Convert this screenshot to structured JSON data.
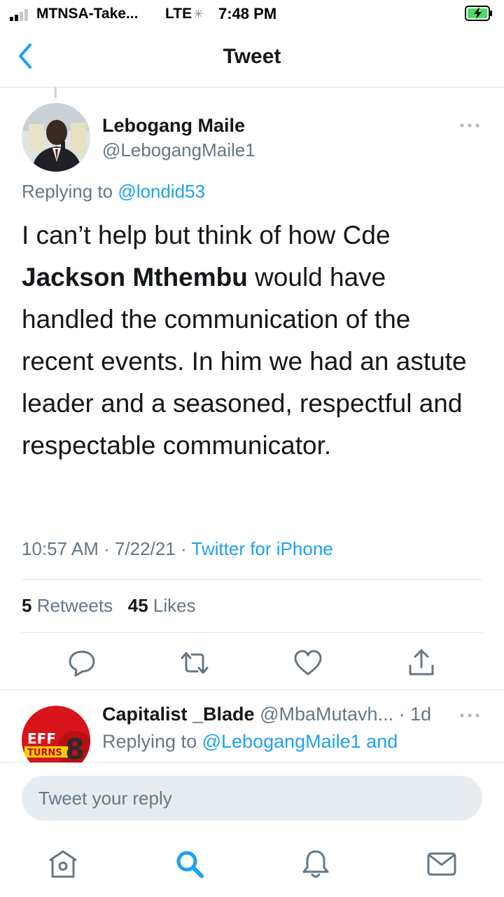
{
  "status_bar": {
    "carrier": "MTNSA-Take...",
    "network": "LTE",
    "time": "7:48 PM",
    "signal_bars": 2,
    "signal_bars_total": 4,
    "battery": "charging"
  },
  "nav": {
    "title": "Tweet",
    "back_icon": "chevron-left-icon"
  },
  "tweet": {
    "author_name": "Lebogang Maile",
    "author_handle": "@LebogangMaile1",
    "replying_prefix": "Replying to",
    "replying_to": "@londid53",
    "text_part1": "I can’t help but think of how Cde ",
    "text_bold": "Jackson Mthembu",
    "text_part2": " would have handled the communication of the recent events. In him we had an astute leader and a seasoned, respectful and respectable communicator.",
    "time": "10:57 AM",
    "date": "7/22/21",
    "source": "Twitter for iPhone",
    "retweets_count": "5",
    "retweets_label": "Retweets",
    "likes_count": "45",
    "likes_label": "Likes"
  },
  "actions": [
    "reply-icon",
    "retweet-icon",
    "like-icon",
    "share-icon"
  ],
  "reply": {
    "name": "Capitalist _Blade",
    "handle": "@MbaMutavh...",
    "age": "· 1d",
    "replying_prefix": "Replying to",
    "replying_to": "@LebogangMaile1 and",
    "avatar_text_top": "EFF",
    "avatar_text_bottom": "TURNS",
    "avatar_number": "8"
  },
  "reply_box": {
    "placeholder": "Tweet your reply"
  },
  "tabbar": [
    "home-icon",
    "search-icon",
    "notifications-icon",
    "messages-icon"
  ],
  "colors": {
    "accent": "#1da1f2",
    "text": "#14171a",
    "secondary": "#657786",
    "divider": "#e1e8ed",
    "battery_charging": "#4cd964"
  }
}
